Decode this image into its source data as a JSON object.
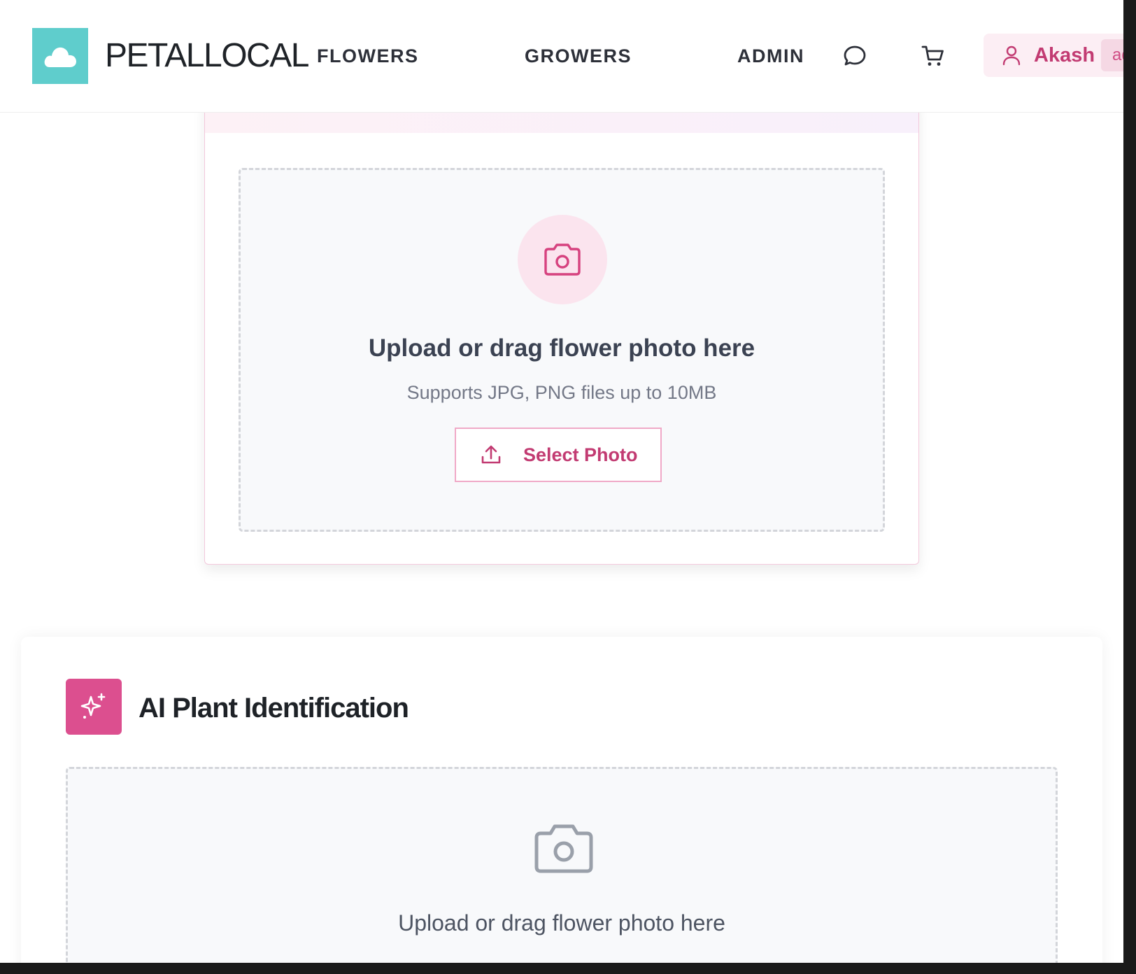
{
  "header": {
    "brand": "PETALLOCAL",
    "nav": [
      {
        "label": "FLOWERS"
      },
      {
        "label": "GROWERS"
      },
      {
        "label": "ADMIN"
      }
    ],
    "icons": {
      "chat": "chat-bubble-icon",
      "cart": "shopping-cart-icon",
      "user": "user-icon",
      "logo": "cloud-icon"
    },
    "user": {
      "name": "Akash",
      "role_chip": "admin"
    }
  },
  "upload_card": {
    "icon": "camera-icon",
    "title": "Upload or drag flower photo here",
    "subtitle": "Supports JPG, PNG files up to 10MB",
    "button_icon": "upload-icon",
    "button_label": "Select Photo"
  },
  "ai_section": {
    "badge_icon": "sparkles-icon",
    "title": "AI Plant Identification",
    "dropzone_icon": "camera-icon",
    "dropzone_title": "Upload or drag flower photo here"
  },
  "colors": {
    "brand_teal": "#5fcdcc",
    "accent_pink": "#dc4f8f",
    "accent_text": "#c23b72",
    "page_bg": "#ffffff",
    "dropzone_bg": "#f8f9fb"
  }
}
